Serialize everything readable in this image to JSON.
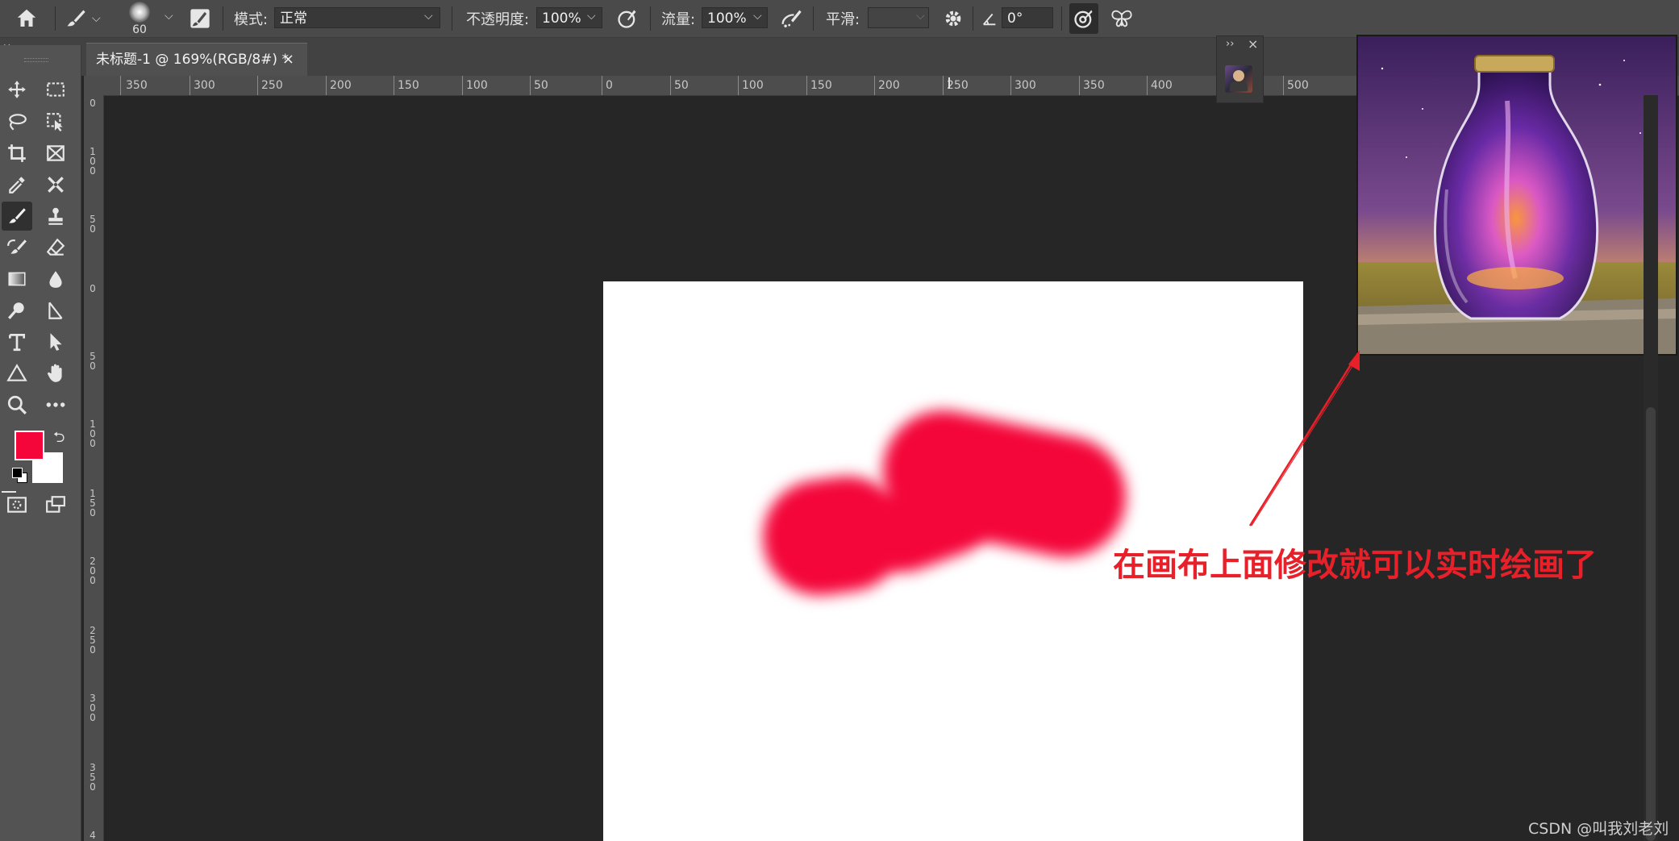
{
  "options_bar": {
    "brush_size": "60",
    "mode_label": "模式:",
    "mode_value": "正常",
    "opacity_label": "不透明度:",
    "opacity_value": "100%",
    "flow_label": "流量:",
    "flow_value": "100%",
    "smoothing_label": "平滑:",
    "smoothing_value": "",
    "angle_value": "0°"
  },
  "document_tab": {
    "title": "未标题-1 @ 169%(RGB/8#) *",
    "close": "×"
  },
  "toolbar": {
    "collapse": "‹‹",
    "tools": [
      "move",
      "marquee",
      "lasso",
      "object-select",
      "crop",
      "frame",
      "eyedropper",
      "healing",
      "brush",
      "stamp",
      "history-brush",
      "eraser",
      "gradient",
      "blur",
      "dodge",
      "pen",
      "type",
      "path-select",
      "shape",
      "hand",
      "zoom",
      "more"
    ]
  },
  "colors": {
    "foreground": "#f4063a",
    "background": "#ffffff",
    "paint": "#f4063a",
    "annotation": "#e8202a"
  },
  "ruler": {
    "horizontal_labels": [
      "350",
      "300",
      "250",
      "200",
      "150",
      "100",
      "50",
      "0",
      "50",
      "100",
      "150",
      "200",
      "250",
      "300",
      "350",
      "400",
      "500"
    ],
    "vertical_labels": [
      "0",
      "100",
      "50",
      "0",
      "50",
      "100",
      "150",
      "200",
      "250",
      "300",
      "350",
      "4"
    ]
  },
  "nav_panel": {
    "expand": "››",
    "close": "×"
  },
  "annotation": {
    "text": "在画布上面修改就可以实时绘画了"
  },
  "watermark": {
    "text": "CSDN @叫我刘老刘"
  }
}
